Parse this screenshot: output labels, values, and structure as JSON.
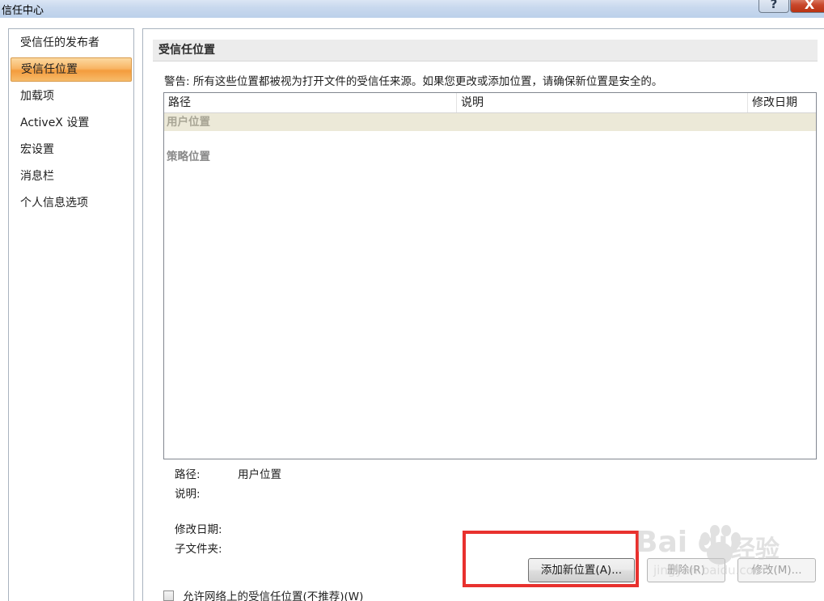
{
  "window": {
    "title": "信任中心",
    "help_label": "?",
    "close_label": "X"
  },
  "sidebar": {
    "items": [
      {
        "label": "受信任的发布者"
      },
      {
        "label": "受信任位置"
      },
      {
        "label": "加载项"
      },
      {
        "label": "ActiveX 设置"
      },
      {
        "label": "宏设置"
      },
      {
        "label": "消息栏"
      },
      {
        "label": "个人信息选项"
      }
    ],
    "active_index": 1
  },
  "main": {
    "section_title": "受信任位置",
    "warning": "警告: 所有这些位置都被视为打开文件的受信任来源。如果您更改或添加位置，请确保新位置是安全的。",
    "list": {
      "columns": [
        "路径",
        "说明",
        "修改日期"
      ],
      "groups": [
        {
          "label": "用户位置",
          "selected": true
        },
        {
          "label": "策略位置",
          "selected": false
        }
      ]
    },
    "details": {
      "path_label": "路径:",
      "path_value": "用户位置",
      "description_label": "说明:",
      "modified_label": "修改日期:",
      "subfolders_label": "子文件夹:"
    },
    "buttons": {
      "add": "添加新位置(A)...",
      "remove": "删除(R)",
      "modify": "修改(M)..."
    },
    "checkbox": {
      "label": "允许网络上的受信任位置(不推荐)(W)",
      "checked": false
    }
  },
  "watermark": {
    "brand": "Bai du",
    "cn": "经验",
    "url": "jingyan.baidu.com"
  }
}
